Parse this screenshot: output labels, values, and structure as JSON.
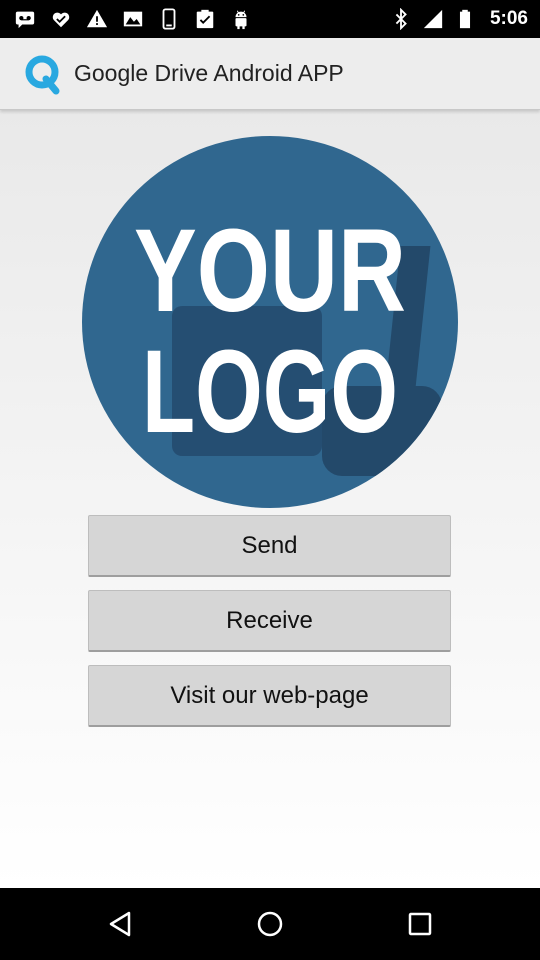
{
  "status_bar": {
    "time": "5:06",
    "icons_left": [
      "voicemail-icon",
      "checkmark-icon",
      "warning-icon",
      "gallery-icon",
      "phone-icon",
      "clipboard-check-icon",
      "android-icon"
    ],
    "icons_right": [
      "bluetooth-icon",
      "signal-icon",
      "battery-icon"
    ]
  },
  "app_bar": {
    "title": "Google Drive Android APP",
    "logo_letter": "Q",
    "logo_color": "#29a8e0"
  },
  "logo": {
    "line1": "YOUR",
    "line2": "LOGO",
    "circle_color": "#30678f"
  },
  "buttons": {
    "send": "Send",
    "receive": "Receive",
    "web": "Visit our web-page"
  },
  "nav_bar": {
    "icons": [
      "back-icon",
      "home-icon",
      "recents-icon"
    ]
  }
}
